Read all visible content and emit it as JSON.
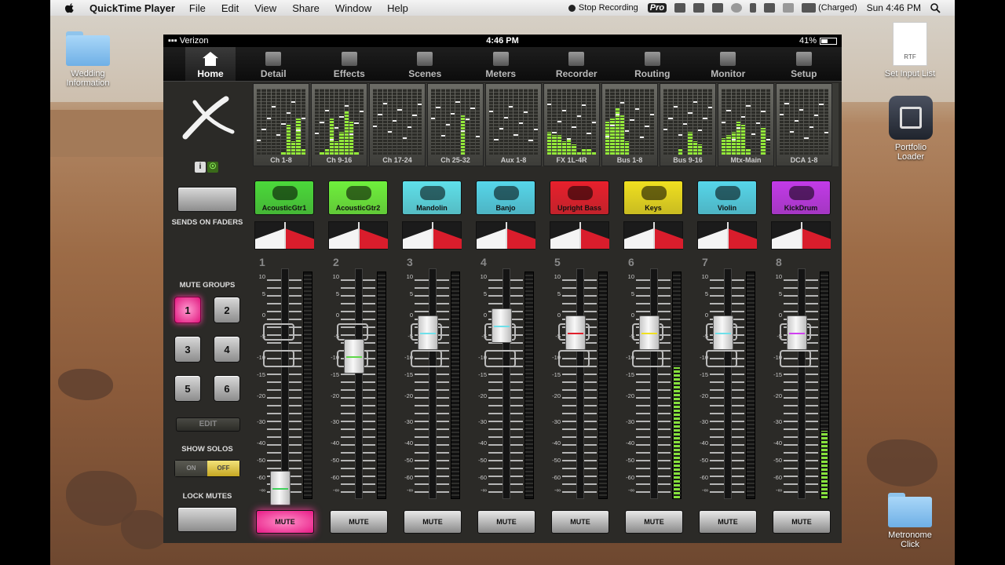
{
  "menubar": {
    "app_name": "QuickTime Player",
    "menus": [
      "File",
      "Edit",
      "View",
      "Share",
      "Window",
      "Help"
    ],
    "stop_recording": "Stop Recording",
    "pro": "Pro",
    "battery": "(Charged)",
    "clock": "Sun 4:46 PM"
  },
  "desktop": {
    "icons": {
      "wedding": "Wedding Information",
      "set_input": "Set Input List",
      "rtf": "RTF",
      "portfolio": "Portfolio Loader",
      "metronome": "Metronome Click"
    }
  },
  "ios": {
    "carrier": "Verizon",
    "time": "4:46 PM",
    "battery": "41%"
  },
  "tabs": [
    {
      "label": "Home",
      "icon": "home-icon"
    },
    {
      "label": "Detail",
      "icon": "detail-icon"
    },
    {
      "label": "Effects",
      "icon": "effects-icon"
    },
    {
      "label": "Scenes",
      "icon": "scenes-icon"
    },
    {
      "label": "Meters",
      "icon": "meters-icon"
    },
    {
      "label": "Recorder",
      "icon": "recorder-icon"
    },
    {
      "label": "Routing",
      "icon": "routing-icon"
    },
    {
      "label": "Monitor",
      "icon": "monitor-icon"
    },
    {
      "label": "Setup",
      "icon": "setup-icon"
    }
  ],
  "left": {
    "info_i": "i",
    "sends_label": "SENDS ON FADERS",
    "mute_groups_label": "MUTE GROUPS",
    "mute_groups": [
      "1",
      "2",
      "3",
      "4",
      "5",
      "6"
    ],
    "edit": "EDIT",
    "show_solos_label": "SHOW SOLOS",
    "toggle_on": "ON",
    "toggle_off": "OFF",
    "lock_mutes_label": "LOCK MUTES"
  },
  "meter_banks": [
    "Ch 1-8",
    "Ch 9-16",
    "Ch 17-24",
    "Ch 25-32",
    "Aux 1-8",
    "FX 1L-4R",
    "Bus 1-8",
    "Bus 9-16",
    "Mtx-Main",
    "DCA 1-8"
  ],
  "fader_scale": [
    "10",
    "5",
    "0",
    "-5",
    "-10",
    "-15",
    "-20",
    "-30",
    "-40",
    "-50",
    "-60",
    "-∞"
  ],
  "channels": [
    {
      "num": "1",
      "name": "AcousticGtr1",
      "color": "#4bd93a",
      "mute": "MUTE",
      "muted": true,
      "fader": 0.02,
      "meter": 0.0,
      "stripe": "#3fd05a"
    },
    {
      "num": "2",
      "name": "AcousticGtr2",
      "color": "#6ff03c",
      "mute": "MUTE",
      "muted": false,
      "fader": 0.62,
      "meter": 0.0,
      "stripe": "#5fd84a"
    },
    {
      "num": "3",
      "name": "Mandolin",
      "color": "#5fe0ea",
      "mute": "MUTE",
      "muted": false,
      "fader": 0.73,
      "meter": 0.0,
      "stripe": "#6fe0ea"
    },
    {
      "num": "4",
      "name": "Banjo",
      "color": "#56d6ea",
      "mute": "MUTE",
      "muted": false,
      "fader": 0.76,
      "meter": 0.0,
      "stripe": "#6fe0ea"
    },
    {
      "num": "5",
      "name": "Upright Bass",
      "color": "#e8202c",
      "mute": "MUTE",
      "muted": false,
      "fader": 0.73,
      "meter": 0.0,
      "stripe": "#e0202c"
    },
    {
      "num": "6",
      "name": "Keys",
      "color": "#f0e020",
      "mute": "MUTE",
      "muted": false,
      "fader": 0.73,
      "meter": 0.58,
      "stripe": "#f0e020"
    },
    {
      "num": "7",
      "name": "Violin",
      "color": "#56d6ea",
      "mute": "MUTE",
      "muted": false,
      "fader": 0.73,
      "meter": 0.0,
      "stripe": "#6fe0ea"
    },
    {
      "num": "8",
      "name": "KickDrum",
      "color": "#c23ae8",
      "mute": "MUTE",
      "muted": false,
      "fader": 0.73,
      "meter": 0.3,
      "stripe": "#d040f0"
    }
  ]
}
